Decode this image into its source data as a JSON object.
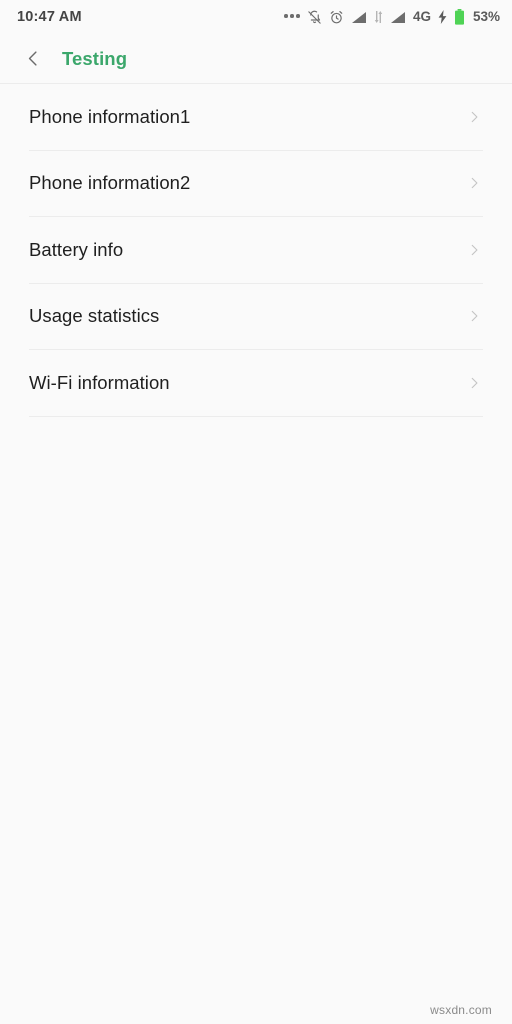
{
  "status_bar": {
    "time": "10:47 AM",
    "network_label": "4G",
    "battery_percent": "53%",
    "icons": [
      "more-dots-icon",
      "notifications-silenced-icon",
      "alarm-clock-icon",
      "signal-bars-sim1-icon",
      "data-transfer-icon",
      "signal-bars-sim2-icon",
      "charging-bolt-icon",
      "battery-icon"
    ],
    "colors": {
      "text": "#5a5a5a",
      "icon": "#6d6d6d",
      "battery_fill": "#4fd355"
    }
  },
  "app_bar": {
    "back_label": "back-chevron",
    "title": "Testing",
    "title_color": "#3ba76b"
  },
  "list": {
    "items": [
      {
        "label": "Phone information1",
        "chevron": "chevron-right-icon"
      },
      {
        "label": "Phone information2",
        "chevron": "chevron-right-icon"
      },
      {
        "label": "Battery info",
        "chevron": "chevron-right-icon"
      },
      {
        "label": "Usage statistics",
        "chevron": "chevron-right-icon"
      },
      {
        "label": "Wi-Fi information",
        "chevron": "chevron-right-icon"
      }
    ]
  },
  "watermark": {
    "text": "wsxdn.com"
  }
}
